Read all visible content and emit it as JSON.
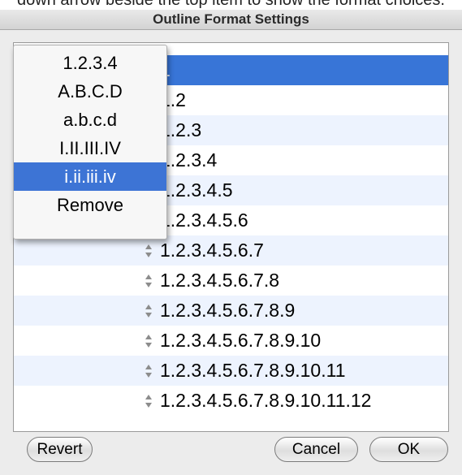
{
  "caption": "down arrow beside the top item to show the format choices.",
  "window": {
    "title": "Outline Format Settings"
  },
  "outline_rows": [
    {
      "label": "1"
    },
    {
      "label": "1.2"
    },
    {
      "label": "1.2.3"
    },
    {
      "label": "1.2.3.4"
    },
    {
      "label": "1.2.3.4.5"
    },
    {
      "label": "1.2.3.4.5.6"
    },
    {
      "label": "1.2.3.4.5.6.7"
    },
    {
      "label": "1.2.3.4.5.6.7.8"
    },
    {
      "label": "1.2.3.4.5.6.7.8.9"
    },
    {
      "label": "1.2.3.4.5.6.7.8.9.10"
    },
    {
      "label": "1.2.3.4.5.6.7.8.9.10.11"
    },
    {
      "label": "1.2.3.4.5.6.7.8.9.10.11.12"
    }
  ],
  "selected_row": "1",
  "format_menu": {
    "items": [
      {
        "label": "1.2.3.4"
      },
      {
        "label": "A.B.C.D"
      },
      {
        "label": "a.b.c.d"
      },
      {
        "label": "I.II.III.IV"
      },
      {
        "label": "i.ii.iii.iv"
      },
      {
        "label": "Remove"
      }
    ],
    "highlighted": "i.ii.iii.iv"
  },
  "buttons": {
    "revert": "Revert",
    "cancel": "Cancel",
    "ok": "OK"
  },
  "colors": {
    "selection": "#3875d7",
    "menu_highlight": "#3d74d5",
    "alt_row": "#edf3fe"
  },
  "icons": {
    "row_stepper": "up-down-arrows-icon"
  }
}
